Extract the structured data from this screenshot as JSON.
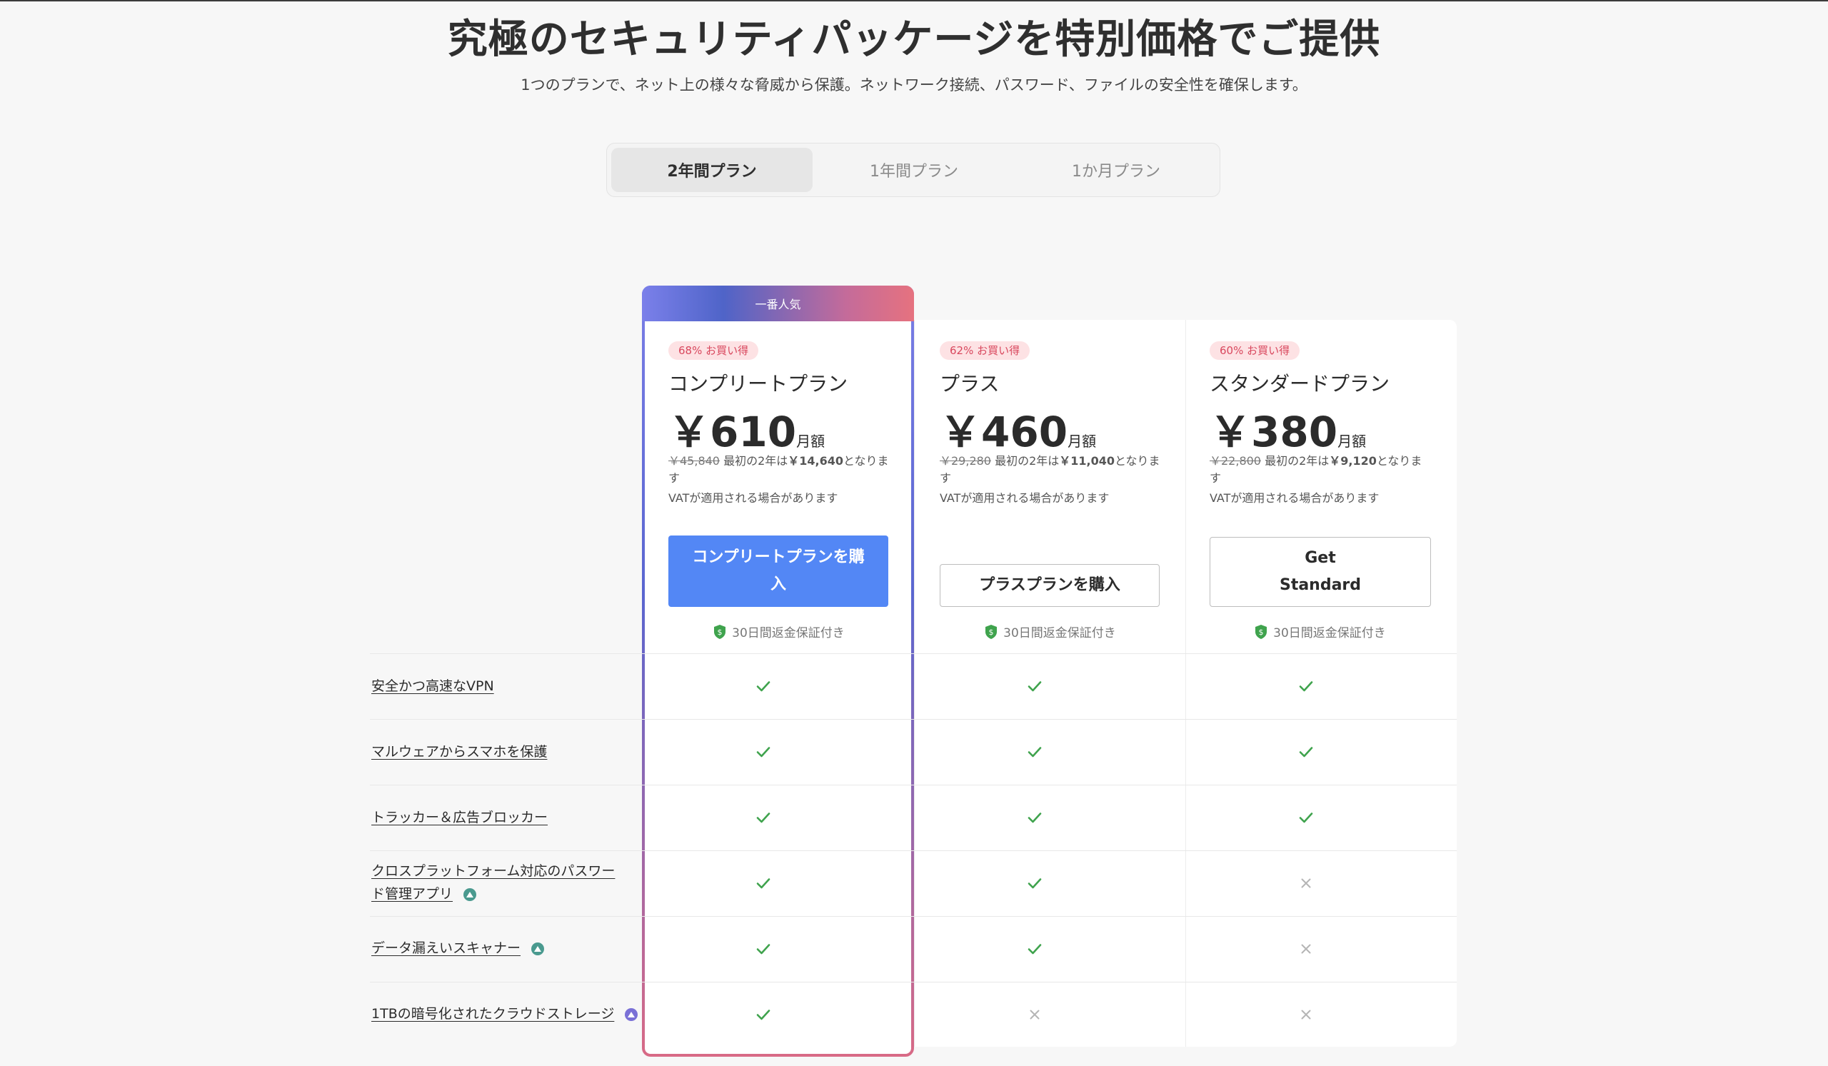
{
  "header": {
    "title": "究極のセキュリティパッケージを特別価格でご提供",
    "subtitle": "1つのプランで、ネット上の様々な脅威から保護。ネットワーク接続、パスワード、ファイルの安全性を確保します。"
  },
  "tabs": [
    {
      "label": "2年間プラン",
      "active": true
    },
    {
      "label": "1年間プラン",
      "active": false
    },
    {
      "label": "1か月プラン",
      "active": false
    }
  ],
  "popular_label": "一番人気",
  "plans": [
    {
      "badge": "68% お買い得",
      "name": "コンプリートプラン",
      "price": "￥610",
      "unit": "月額",
      "old_price": "￥45,840",
      "note_pre": "最初の2年は",
      "note_price": "￥14,640",
      "note_post": "となります",
      "vat": "VATが適用される場合があります",
      "button": "コンプリートプランを購入",
      "guarantee": "30日間返金保証付き"
    },
    {
      "badge": "62% お買い得",
      "name": "プラス",
      "price": "￥460",
      "unit": "月額",
      "old_price": "￥29,280",
      "note_pre": "最初の2年は",
      "note_price": "￥11,040",
      "note_post": "となります",
      "vat": "VATが適用される場合があります",
      "button": "プラスプランを購入",
      "guarantee": "30日間返金保証付き"
    },
    {
      "badge": "60% お買い得",
      "name": "スタンダードプラン",
      "price": "￥380",
      "unit": "月額",
      "old_price": "￥22,800",
      "note_pre": "最初の2年は",
      "note_price": "￥9,120",
      "note_post": "となります",
      "vat": "VATが適用される場合があります",
      "button_line1": "Get",
      "button_line2": "Standard",
      "guarantee": "30日間返金保証付き"
    }
  ],
  "features": [
    {
      "label": "安全かつ高速なVPN",
      "included": [
        true,
        true,
        true
      ]
    },
    {
      "label": "マルウェアからスマホを保護",
      "included": [
        true,
        true,
        true
      ]
    },
    {
      "label": "トラッカー＆広告ブロッカー",
      "included": [
        true,
        true,
        true
      ]
    },
    {
      "label_line1": "クロスプラットフォーム対応のパスワー",
      "label_line2": "ド管理アプリ",
      "icon": "password-app-icon",
      "included": [
        true,
        true,
        false
      ]
    },
    {
      "label": "データ漏えいスキャナー",
      "icon": "scanner-icon",
      "included": [
        true,
        true,
        false
      ]
    },
    {
      "label": "1TBの暗号化されたクラウドストレージ",
      "icon": "cloud-storage-icon",
      "included": [
        true,
        false,
        false
      ]
    }
  ],
  "colors": {
    "accent": "#5387f5",
    "check": "#3fa34d",
    "cross": "#b5b5b5",
    "badge_text": "#d9485e",
    "badge_bg": "#fde2e4"
  }
}
